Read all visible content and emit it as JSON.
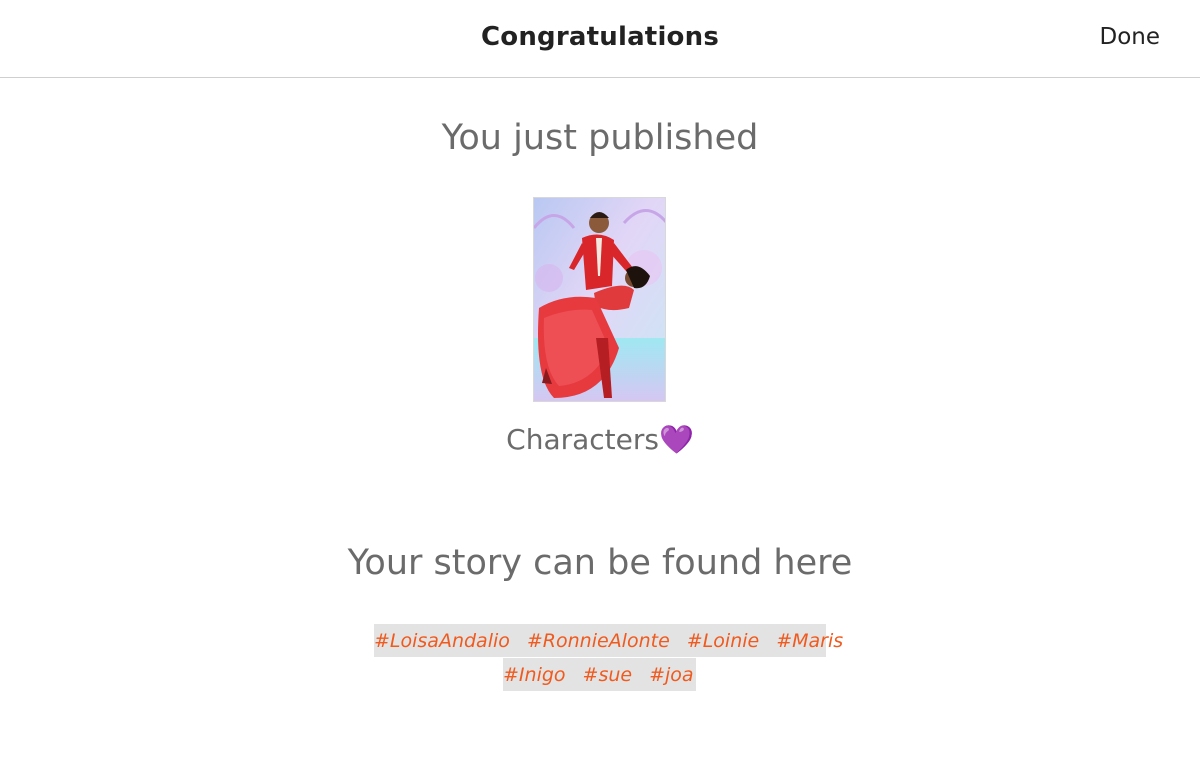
{
  "header": {
    "title": "Congratulations",
    "done_label": "Done"
  },
  "published": {
    "heading": "You just published",
    "story_title": "Characters",
    "story_emoji": "💜",
    "cover_icon": "story-cover-image"
  },
  "tags_section": {
    "heading": "Your story can be found here",
    "rows": [
      [
        "#LoisaAndalio",
        "#RonnieAlonte",
        "#Loinie",
        "#Maris"
      ],
      [
        "#Inigo",
        "#sue",
        "#joa"
      ]
    ]
  },
  "colors": {
    "tag": "#f05a1e",
    "tag_bg": "#e3e3e3",
    "heading_text": "#6b6b6b",
    "header_text": "#222222"
  }
}
